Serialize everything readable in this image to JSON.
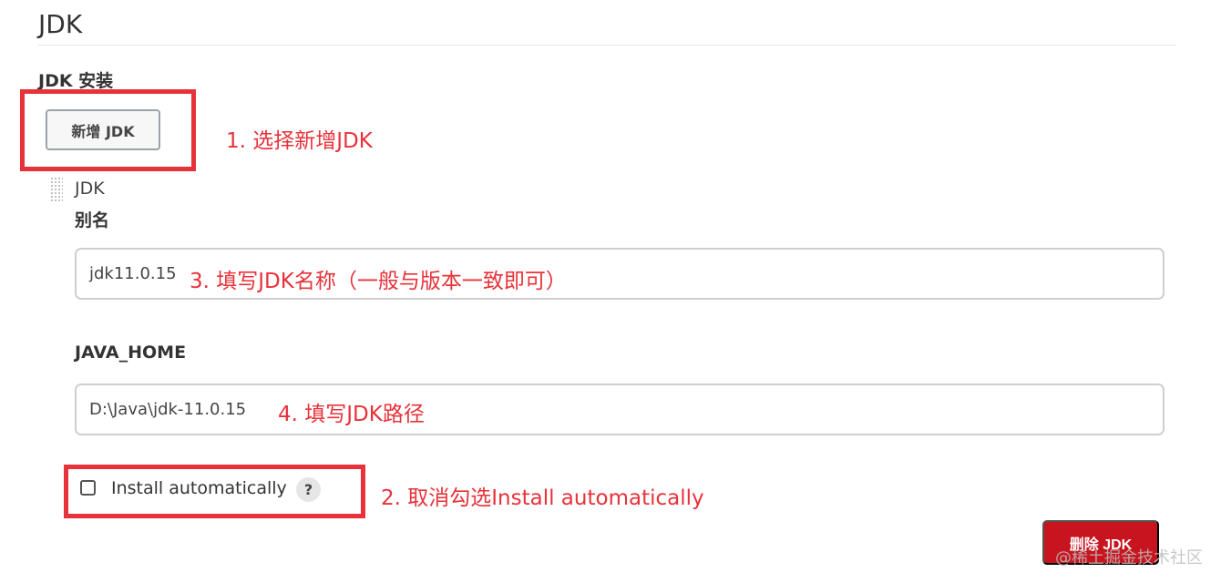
{
  "section": {
    "title": "JDK",
    "install_label": "JDK 安装",
    "add_button_label": "新增 JDK"
  },
  "jdk_item": {
    "title": "JDK",
    "alias_label": "别名",
    "alias_value": "jdk11.0.15",
    "java_home_label": "JAVA_HOME",
    "java_home_value": "D:\\Java\\jdk-11.0.15",
    "install_automatically_label": "Install automatically",
    "install_automatically_checked": false,
    "help_icon": "?",
    "delete_button_label": "删除 JDK"
  },
  "annotations": {
    "step1": "1. 选择新增JDK",
    "step2": "2. 取消勾选Install automatically",
    "step3": "3. 填写JDK名称（一般与版本一致即可）",
    "step4": "4. 填写JDK路径"
  },
  "watermark": "@稀土掘金技术社区",
  "colors": {
    "annotation_red": "#e8323a",
    "delete_button": "#c8141e"
  }
}
